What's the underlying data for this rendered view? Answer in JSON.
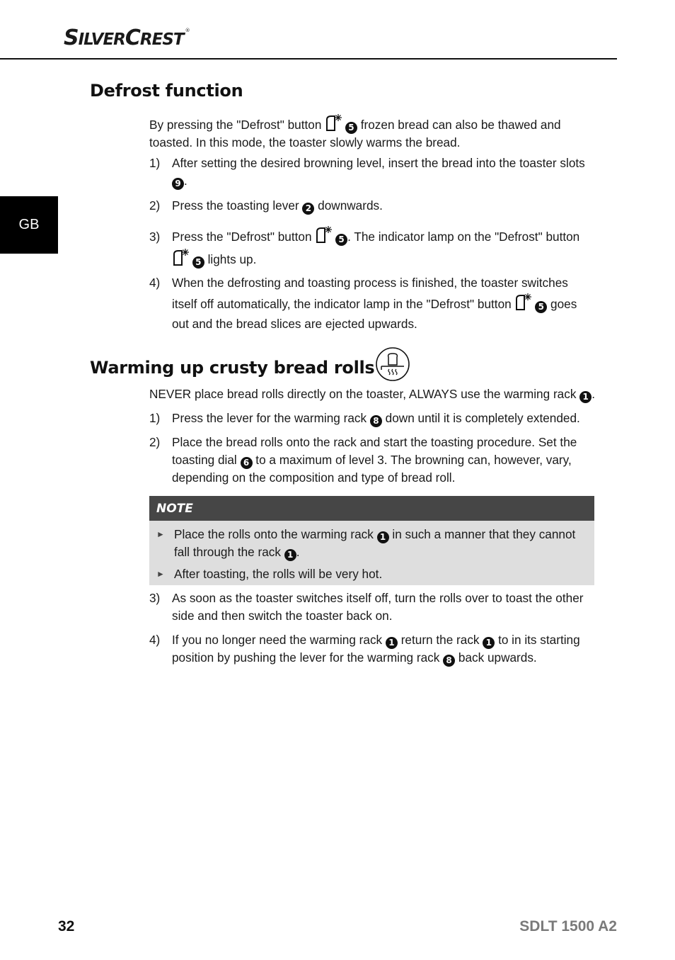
{
  "header": {
    "brand_big1": "S",
    "brand_small1": "ILVER",
    "brand_big2": "C",
    "brand_small2": "REST",
    "brand_reg": "®"
  },
  "language_tab": "GB",
  "defrost": {
    "title": "Defrost function",
    "intro_a": "By pressing the \"Defrost\" button",
    "intro_ref": "5",
    "intro_b": "frozen bread can also be thawed and toasted. In this mode, the toaster slowly warms the bread.",
    "steps": [
      {
        "num": "1)",
        "a": "After setting the desired browning level, insert the bread into the toaster slots",
        "ref": "9",
        "b": "."
      },
      {
        "num": "2)",
        "a": "Press the toasting lever",
        "ref": "2",
        "b": "downwards."
      },
      {
        "num": "3)",
        "a": "Press the \"Defrost\" button",
        "ref": "5",
        "b": ". The indicator lamp on the \"Defrost\" button",
        "ref2": "5",
        "c": "lights up."
      },
      {
        "num": "4)",
        "a": "When the defrosting and toasting process is finished, the toaster switches itself off automatically, the indicator lamp in the \"Defrost\" button",
        "ref": "5",
        "b": "goes out and the bread slices are ejected upwards."
      }
    ]
  },
  "rolls": {
    "title": "Warming up crusty bread rolls",
    "intro_a": "NEVER place bread rolls directly on the toaster, ALWAYS use the warming rack",
    "intro_ref": "1",
    "intro_b": ".",
    "steps": [
      {
        "num": "1)",
        "a": "Press the lever for the warming rack",
        "ref": "8",
        "b": "down until it is completely extended."
      },
      {
        "num": "2)",
        "a": "Place the bread rolls onto the rack and start the toasting procedure. Set the toasting dial",
        "ref": "6",
        "b": "to a maximum of level 3. The browning can, however, vary, depending on the composition and type of bread roll."
      },
      {
        "num": "3)",
        "a": "As soon as the toaster switches itself off, turn the rolls over to toast the other side and then switch the toaster back on."
      },
      {
        "num": "4)",
        "a": "If you no longer need the warming rack",
        "ref": "1",
        "b": "return the rack",
        "ref2": "1",
        "c": "to in its starting position by pushing the lever for the warming rack",
        "ref3": "8",
        "d": "back upwards."
      }
    ],
    "note": {
      "label": "NOTE",
      "items": [
        {
          "a": "Place the rolls onto the warming rack",
          "ref": "1",
          "b": "in such a manner that they cannot fall through the rack",
          "ref2": "1",
          "c": "."
        },
        {
          "a": "After toasting, the rolls will be very hot."
        }
      ]
    }
  },
  "footer": {
    "page": "32",
    "model": "SDLT 1500 A2"
  }
}
